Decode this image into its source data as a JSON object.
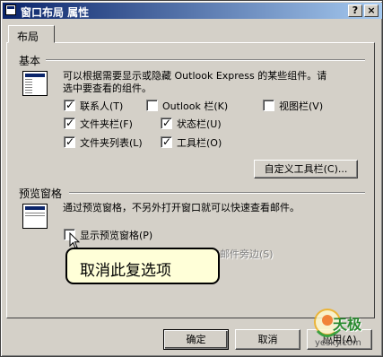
{
  "window": {
    "title": "窗口布局 属性",
    "help_button": "?",
    "close_button": "×"
  },
  "tabs": [
    {
      "label": "布局",
      "selected": true
    }
  ],
  "basic": {
    "label": "基本",
    "description": "可以根据需要显示或隐藏 Outlook Express 的某些组件。请选中要查看的组件。",
    "options": [
      {
        "label": "联系人(T)",
        "checked": true
      },
      {
        "label": "Outlook 栏(K)",
        "checked": false
      },
      {
        "label": "视图栏(V)",
        "checked": false
      },
      {
        "label": "文件夹栏(F)",
        "checked": true
      },
      {
        "label": "状态栏(U)",
        "checked": true
      },
      {
        "label": "文件夹列表(L)",
        "checked": true
      },
      {
        "label": "工具栏(O)",
        "checked": true
      }
    ],
    "customize_button": "自定义工具栏(C)..."
  },
  "preview": {
    "label": "预览窗格",
    "description": "通过预览窗格，不另外打开窗口就可以快速查看邮件。",
    "show_option": {
      "label": "显示预览窗格(P)",
      "checked": false
    },
    "beside_option": {
      "label": "在邮件旁边(S)",
      "enabled": false
    }
  },
  "callout": {
    "text": "取消此复选项"
  },
  "footer": {
    "ok_button": "确定",
    "cancel_button": "取消",
    "apply_button": "应用(A)"
  },
  "watermark": {
    "brand": "天极",
    "domain": "yesky.com"
  }
}
